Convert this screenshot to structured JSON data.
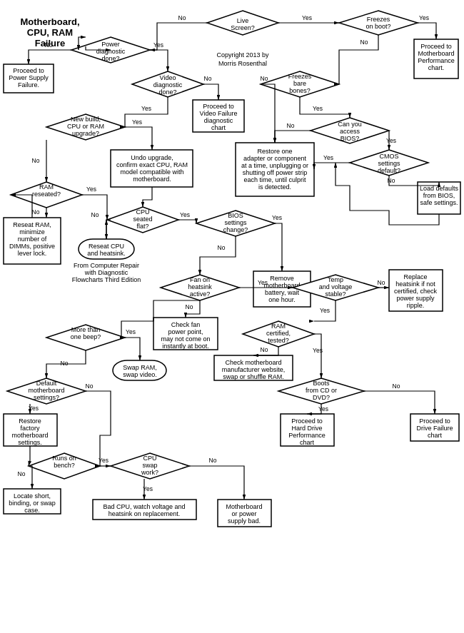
{
  "title": "Motherboard, CPU, RAM Failure",
  "copyright": "Copyright 2013 by Morris Rosenthal",
  "nodes": {
    "title": "Motherboard,\nCPU, RAM\nFailure",
    "live_screen": "Live\nScreen?",
    "freezes_on_boot": "Freezes\non boot?",
    "power_diag": "Power\ndiagnostic\ndone?",
    "video_diag": "Video\ndiagnostic\ndone?",
    "freezes_bare": "Freezes\nbare\nbones?",
    "proceed_power": "Proceed to\nPower Supply\nFailure.",
    "proceed_video": "Proceed to\nVideo Failure\ndiagnostic\nchart",
    "proceed_mobo_perf": "Proceed to\nMotherboard\nPerformance\nchart.",
    "new_build": "New build,\nCPU or RAM\nupgrade?",
    "undo_upgrade": "Undo upgrade,\nconfirm exact CPU, RAM\nmodel compatible with\nmotherboard.",
    "access_bios": "Can you\naccess\nBIOS?",
    "restore_adapter": "Restore one\nadapter or component\nat a time, unplugging or\nshutting off power strip\neach time, until culprit\nis detected.",
    "cmos_default": "CMOS\nsettings\ndefault?",
    "load_defaults": "Load defaults\nfrom BIOS,\nsafe settings.",
    "ram_reseated": "RAM\nreseated?",
    "reseat_ram": "Reseat RAM,\nminimize\nnumber of\nDIMMs, positive\nlever lock.",
    "cpu_seated": "CPU\nseated\nflat?",
    "reseat_cpu": "Reseat CPU\nand heatsink.",
    "bios_change": "BIOS\nsettings\nchange?",
    "fan_heatsink": "Fan on\nheatsink\nactive?",
    "remove_mobo_battery": "Remove\nmotherboard\nbattery, wait\none hour.",
    "temp_voltage": "Temp\nand voltage\nstable?",
    "replace_heatsink": "Replace\nheatsink if not\ncertified, check\npower supply\nripple.",
    "check_fan": "Check fan\npower point,\nmay not come on\ninstantly at boot.",
    "ram_certified": "RAM\ncertified,\ntested?",
    "check_mobo_mfr": "Check motherboard\nmanufacturer website,\nswap or shuffle RAM.",
    "more_than_one_beep": "More than\none beep?",
    "default_mobo": "Default\nmotherboard\nsettings?",
    "swap_ram_video": "Swap RAM,\nswap video.",
    "restore_factory": "Restore\nfactory\nmotherboard\nsettings.",
    "boots_cd_dvd": "Boots\nfrom CD or\nDVD?",
    "proceed_hard_drive": "Proceed to\nHard Drive\nPerformance\nchart",
    "proceed_drive_failure": "Proceed to\nDrive Failure\nchart",
    "runs_on_bench": "Runs on\nbench?",
    "locate_short": "Locate short,\nbinding, or swap\ncase.",
    "cpu_swap": "CPU\nswap\nwork?",
    "bad_cpu": "Bad CPU, watch voltage and\nheatsink on replacement.",
    "mobo_power_bad": "Motherboard\nor power\nsupply bad.",
    "from_computer_repair": "From Computer Repair\nwith Diagnostic\nFlowcharts Third Edition"
  }
}
